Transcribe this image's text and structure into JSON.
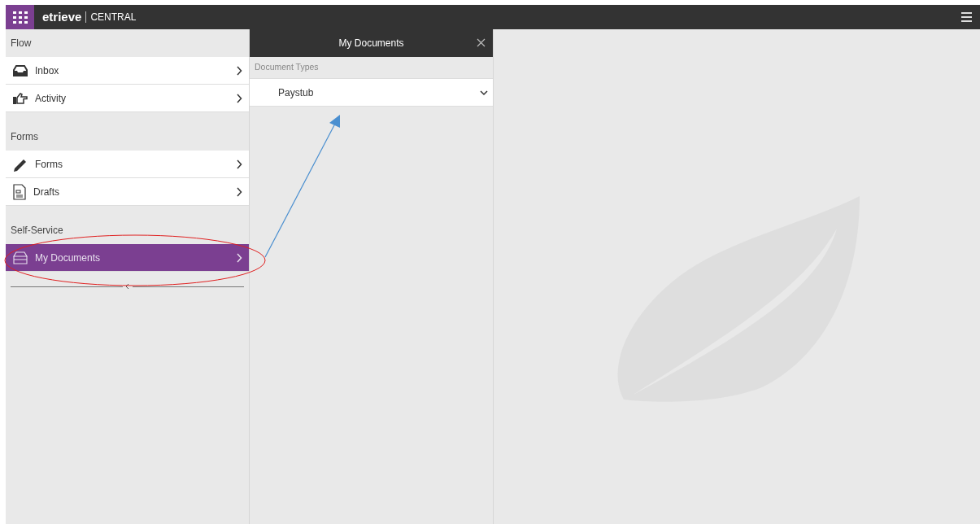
{
  "topbar": {
    "brand": "etrieve",
    "product": "CENTRAL"
  },
  "sidebar": {
    "sections": [
      {
        "title": "Flow",
        "items": [
          {
            "label": "Inbox",
            "selected": false
          },
          {
            "label": "Activity",
            "selected": false
          }
        ]
      },
      {
        "title": "Forms",
        "items": [
          {
            "label": "Forms",
            "selected": false
          },
          {
            "label": "Drafts",
            "selected": false
          }
        ]
      },
      {
        "title": "Self-Service",
        "items": [
          {
            "label": "My Documents",
            "selected": true
          }
        ]
      }
    ]
  },
  "panel": {
    "title": "My Documents",
    "section_label": "Document Types",
    "groups": [
      {
        "label": "Paystub",
        "expanded": false
      }
    ]
  },
  "annotations": [
    {
      "kind": "ellipse",
      "color": "#e02020"
    },
    {
      "kind": "arrow",
      "color": "#4a8fd0"
    }
  ]
}
